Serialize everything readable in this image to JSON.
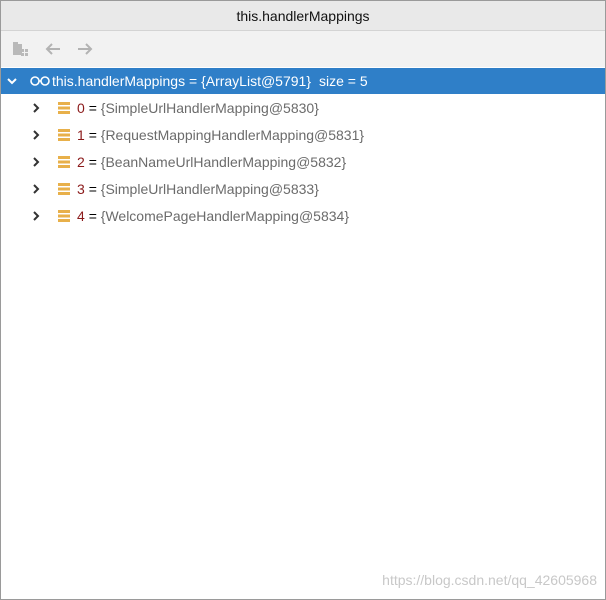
{
  "window": {
    "title": "this.handlerMappings"
  },
  "toolbar": {
    "buttons": [
      {
        "icon": "folder-grid-icon"
      },
      {
        "icon": "arrow-left-icon"
      },
      {
        "icon": "arrow-right-icon"
      }
    ]
  },
  "tree": {
    "root": {
      "name": "this.handlerMappings",
      "equals": "=",
      "value": "{ArrayList@5791}",
      "size": "size = 5",
      "expanded": true,
      "selected": true
    },
    "children": [
      {
        "index": "0",
        "equals": "=",
        "value": "{SimpleUrlHandlerMapping@5830}"
      },
      {
        "index": "1",
        "equals": "=",
        "value": "{RequestMappingHandlerMapping@5831}"
      },
      {
        "index": "2",
        "equals": "=",
        "value": "{BeanNameUrlHandlerMapping@5832}"
      },
      {
        "index": "3",
        "equals": "=",
        "value": "{SimpleUrlHandlerMapping@5833}"
      },
      {
        "index": "4",
        "equals": "=",
        "value": "{WelcomePageHandlerMapping@5834}"
      }
    ]
  },
  "watermark": "https://blog.csdn.net/qq_42605968",
  "colors": {
    "selection": "#2f7fc8",
    "index_text": "#8b1a1a",
    "value_text": "#6b6b6b",
    "field_icon": "#e8b04a"
  }
}
